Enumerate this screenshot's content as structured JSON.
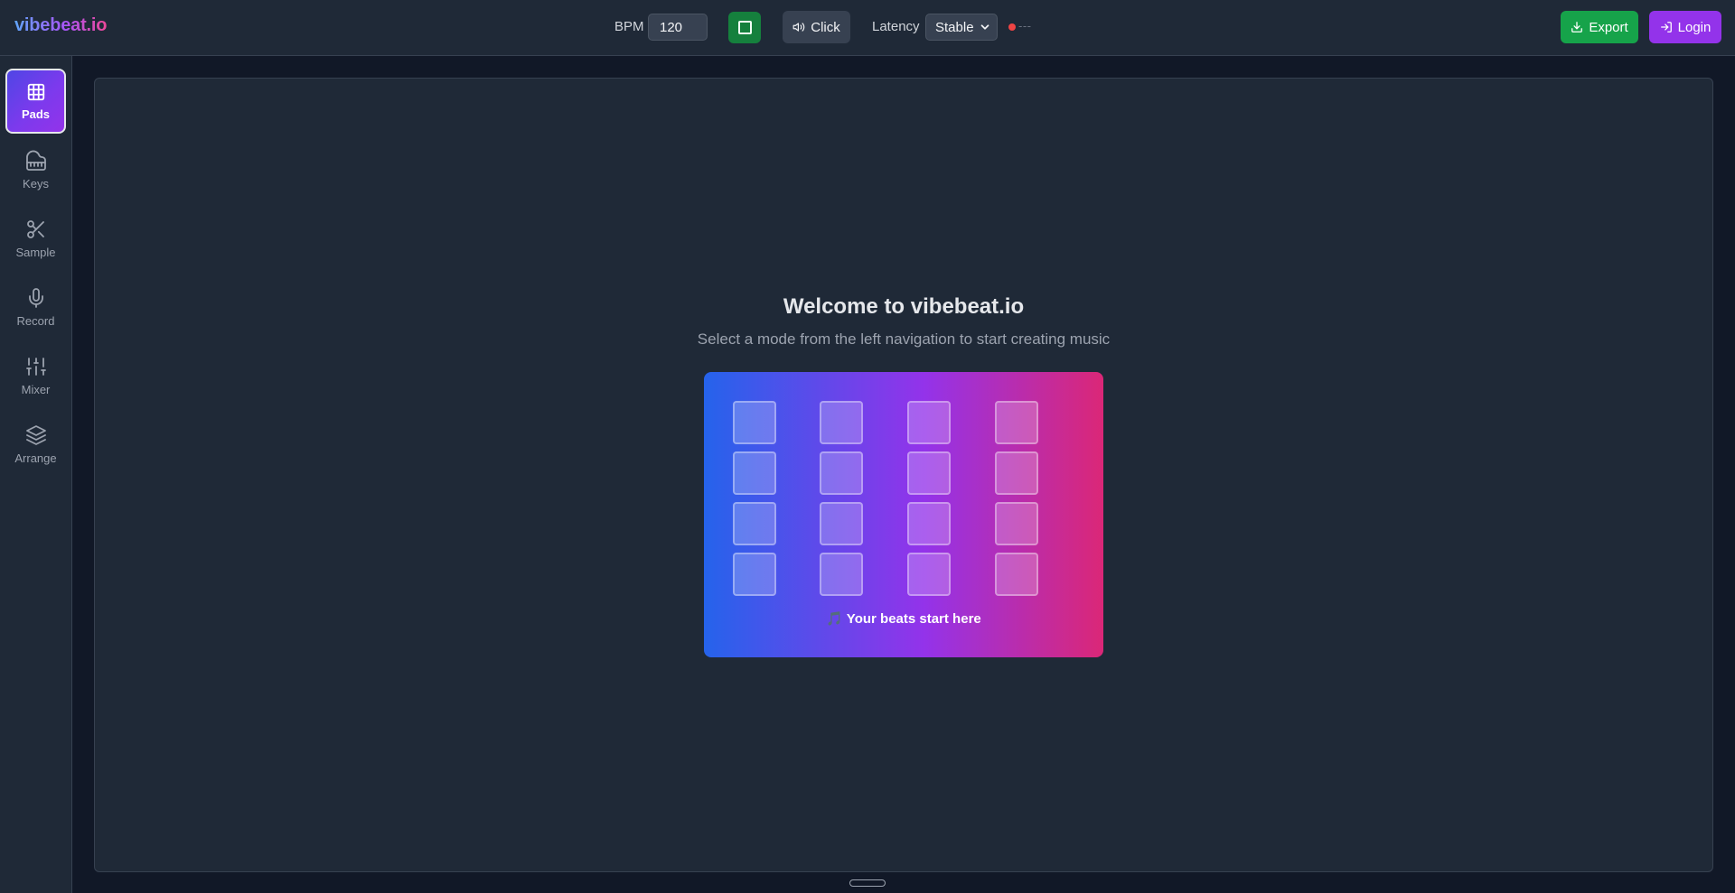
{
  "header": {
    "logo": "vibebeat.io",
    "bpm_label": "BPM",
    "bpm_value": "120",
    "stop_icon": "stop-square-icon",
    "click_label": "Click",
    "click_icon": "speaker-icon",
    "latency_label": "Latency",
    "latency_value": "Stable",
    "latency_status_text": "---",
    "latency_status_color": "#ef4444",
    "export_label": "Export",
    "export_icon": "download-icon",
    "login_label": "Login",
    "login_icon": "login-icon"
  },
  "sidebar": {
    "items": [
      {
        "label": "Pads",
        "icon": "grid-icon",
        "active": true
      },
      {
        "label": "Keys",
        "icon": "piano-icon",
        "active": false
      },
      {
        "label": "Sample",
        "icon": "scissors-icon",
        "active": false
      },
      {
        "label": "Record",
        "icon": "microphone-icon",
        "active": false
      },
      {
        "label": "Mixer",
        "icon": "sliders-icon",
        "active": false
      },
      {
        "label": "Arrange",
        "icon": "layers-icon",
        "active": false
      }
    ]
  },
  "main": {
    "title": "Welcome to vibebeat.io",
    "subtitle": "Select a mode from the left navigation to start creating music",
    "hero_caption": "🎵 Your beats start here"
  },
  "colors": {
    "background": "#111827",
    "panel": "#1f2937",
    "accent_green": "#16a34a",
    "accent_purple": "#9333ea",
    "gradient_start": "#2563eb",
    "gradient_end": "#db2777"
  }
}
